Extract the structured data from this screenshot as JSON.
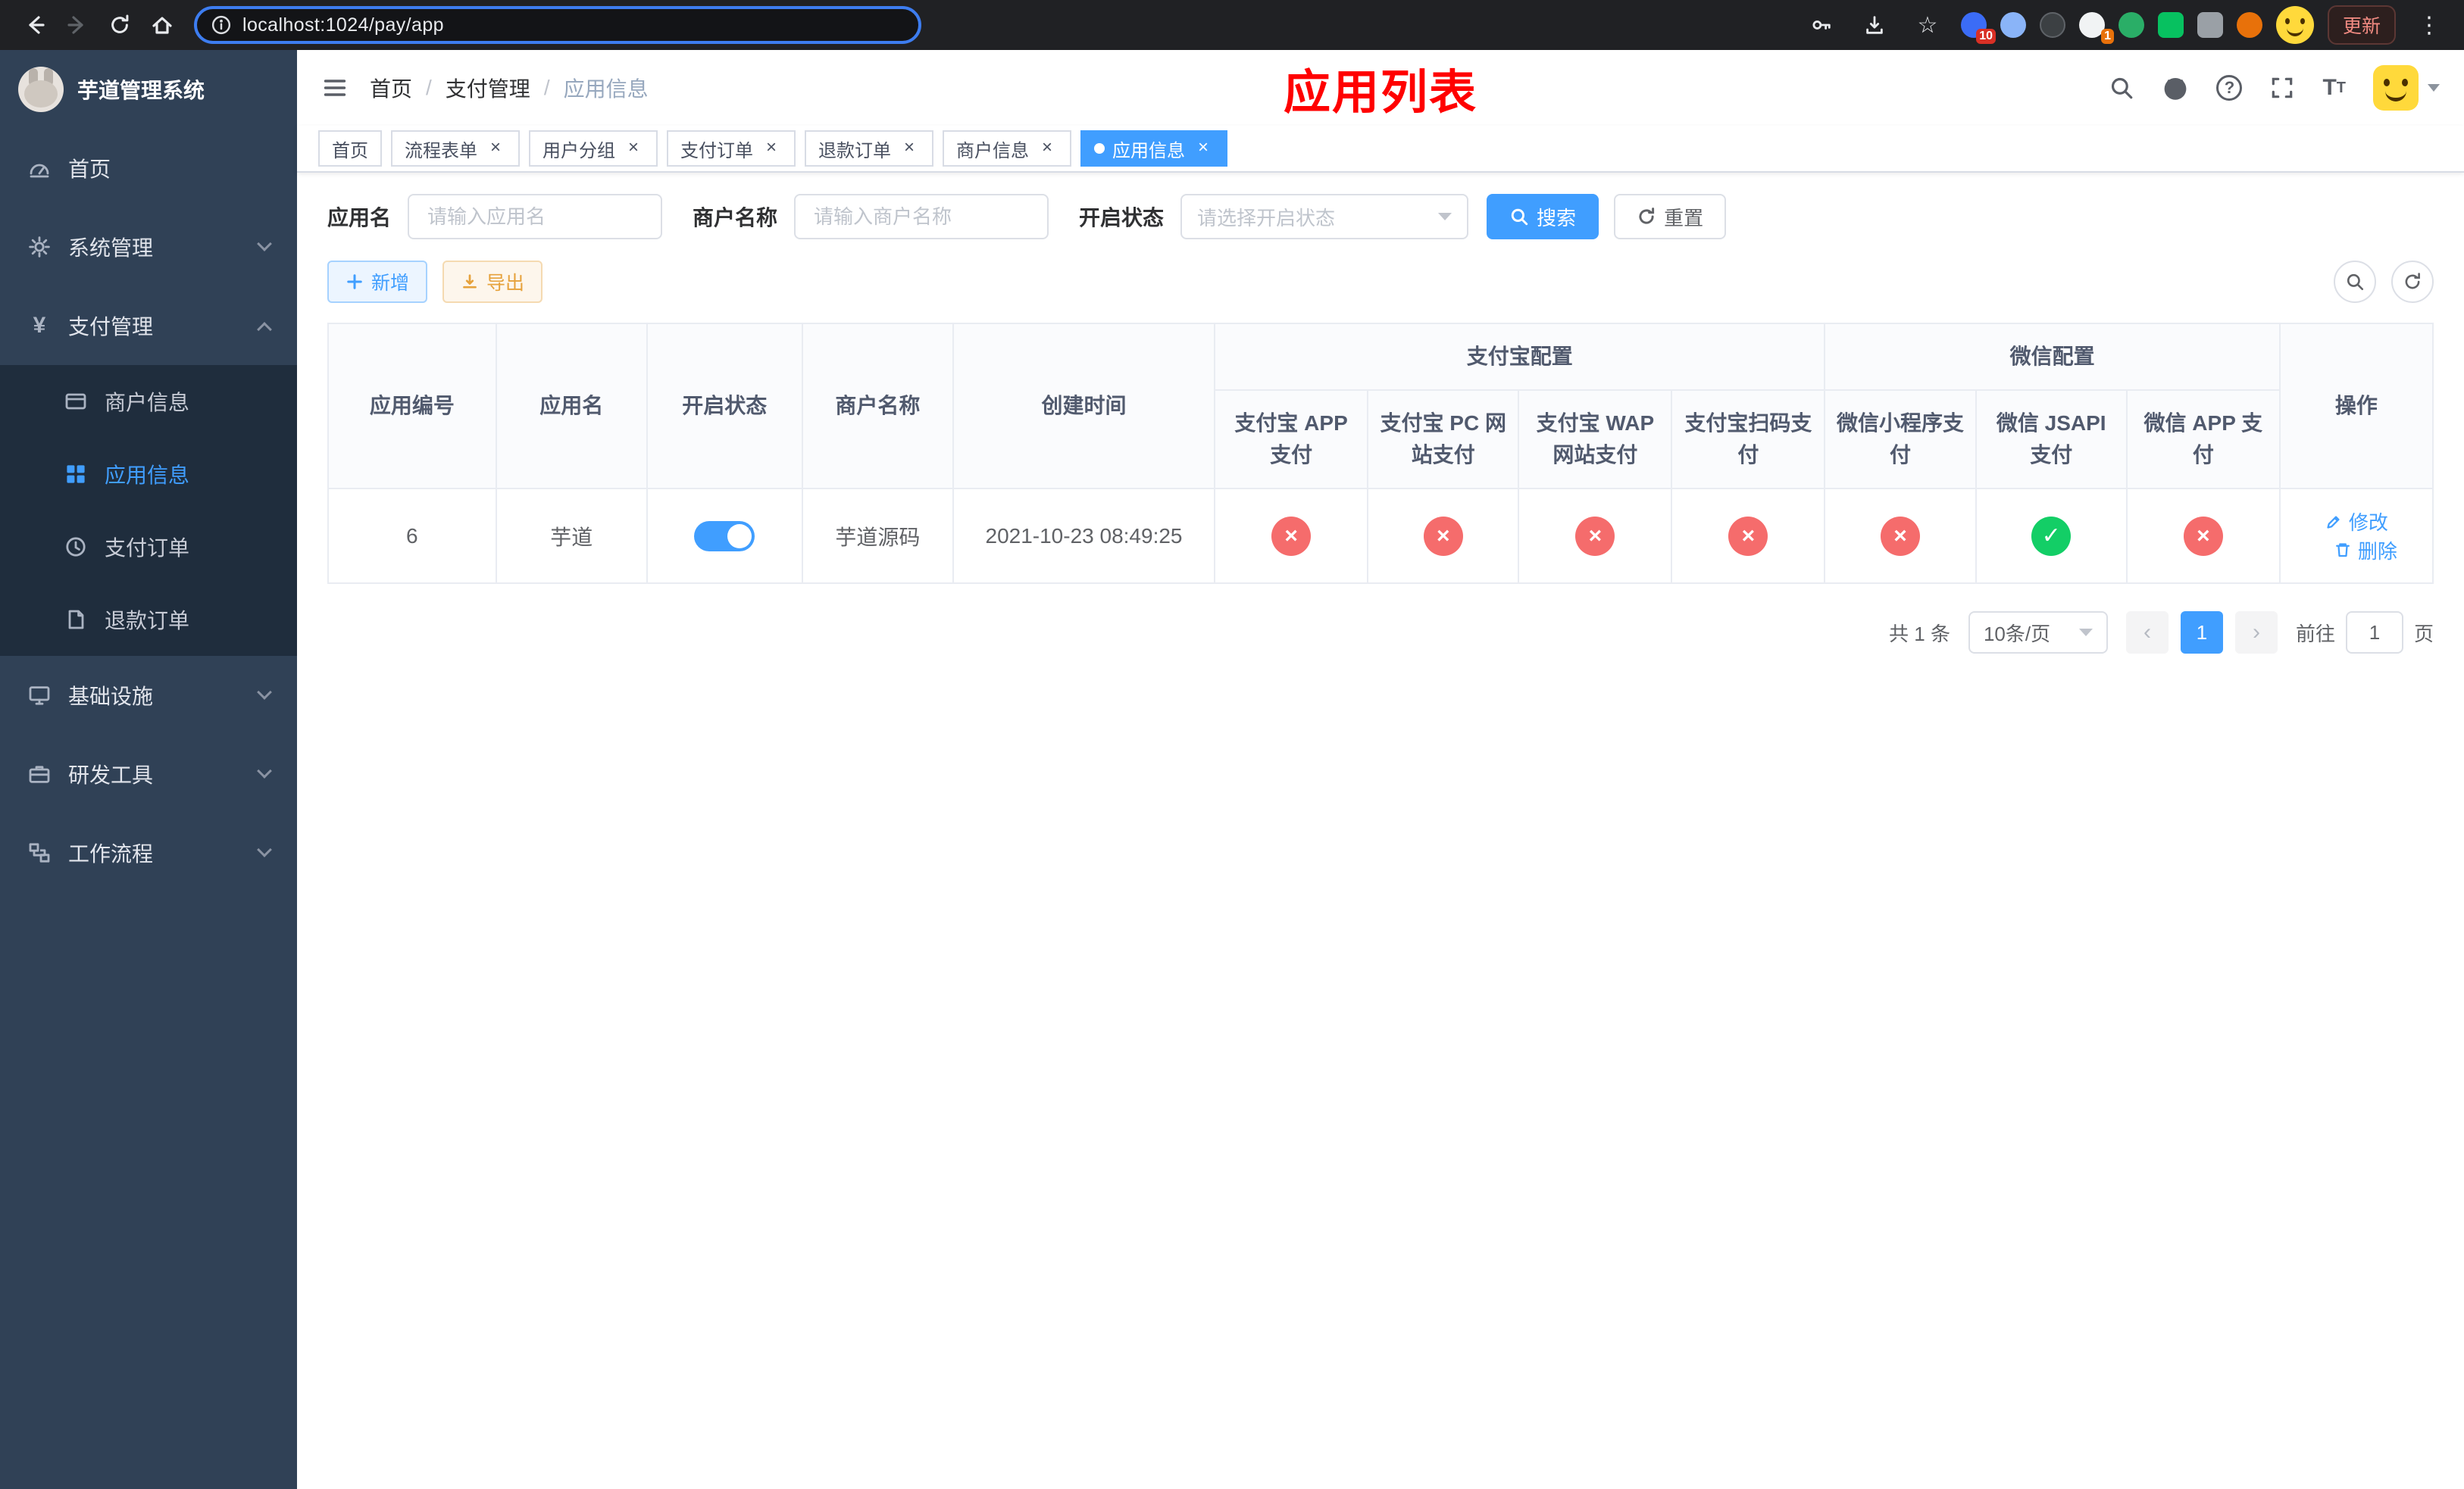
{
  "browser": {
    "url": "localhost:1024/pay/app",
    "update_button": "更新",
    "ext_badge_1": "10",
    "ext_badge_2": "1"
  },
  "page_annotation": "应用列表",
  "sidebar": {
    "app_title": "芋道管理系统",
    "items": [
      {
        "label": "首页"
      },
      {
        "label": "系统管理"
      },
      {
        "label": "支付管理"
      },
      {
        "label": "基础设施"
      },
      {
        "label": "研发工具"
      },
      {
        "label": "工作流程"
      }
    ],
    "pay_submenu": [
      {
        "label": "商户信息"
      },
      {
        "label": "应用信息"
      },
      {
        "label": "支付订单"
      },
      {
        "label": "退款订单"
      }
    ]
  },
  "breadcrumb": [
    "首页",
    "支付管理",
    "应用信息"
  ],
  "tabs": [
    {
      "label": "首页"
    },
    {
      "label": "流程表单"
    },
    {
      "label": "用户分组"
    },
    {
      "label": "支付订单"
    },
    {
      "label": "退款订单"
    },
    {
      "label": "商户信息"
    },
    {
      "label": "应用信息"
    }
  ],
  "filters": {
    "app_name_label": "应用名",
    "app_name_placeholder": "请输入应用名",
    "merchant_label": "商户名称",
    "merchant_placeholder": "请输入商户名称",
    "status_label": "开启状态",
    "status_placeholder": "请选择开启状态",
    "search_button": "搜索",
    "reset_button": "重置"
  },
  "toolbar": {
    "add_button": "新增",
    "export_button": "导出"
  },
  "table": {
    "group_headers": {
      "alipay": "支付宝配置",
      "wechat": "微信配置"
    },
    "columns": {
      "id": "应用编号",
      "name": "应用名",
      "status": "开启状态",
      "merchant": "商户名称",
      "created": "创建时间",
      "alipay_app": "支付宝 APP 支付",
      "alipay_pc": "支付宝 PC 网站支付",
      "alipay_wap": "支付宝 WAP 网站支付",
      "alipay_qr": "支付宝扫码支付",
      "wx_lite": "微信小程序支付",
      "wx_jsapi": "微信 JSAPI 支付",
      "wx_app": "微信 APP 支付",
      "actions": "操作"
    },
    "rows": [
      {
        "id": "6",
        "name": "芋道",
        "enabled": true,
        "merchant": "芋道源码",
        "created": "2021-10-23 08:49:25",
        "alipay_app": false,
        "alipay_pc": false,
        "alipay_wap": false,
        "alipay_qr": false,
        "wx_lite": false,
        "wx_jsapi": true,
        "wx_app": false,
        "edit": "修改",
        "delete": "删除"
      }
    ]
  },
  "pagination": {
    "total": "共 1 条",
    "page_size": "10条/页",
    "current_page": "1",
    "goto_prefix": "前往",
    "goto_value": "1",
    "goto_suffix": "页"
  },
  "icons": {
    "close": "×",
    "cross": "×",
    "check": "✓",
    "yen": "¥",
    "star": "☆",
    "dots": "⋮",
    "prev": "‹",
    "next": "›"
  },
  "colors": {
    "accent": "#409EFF",
    "danger": "#F56C6C",
    "success": "#13CE66",
    "warning": "#E6A23C",
    "sidebar_bg": "#304156",
    "submenu_bg": "#1F2D3D",
    "annotation_red": "#FF0000",
    "chrome_bg": "#202124"
  }
}
